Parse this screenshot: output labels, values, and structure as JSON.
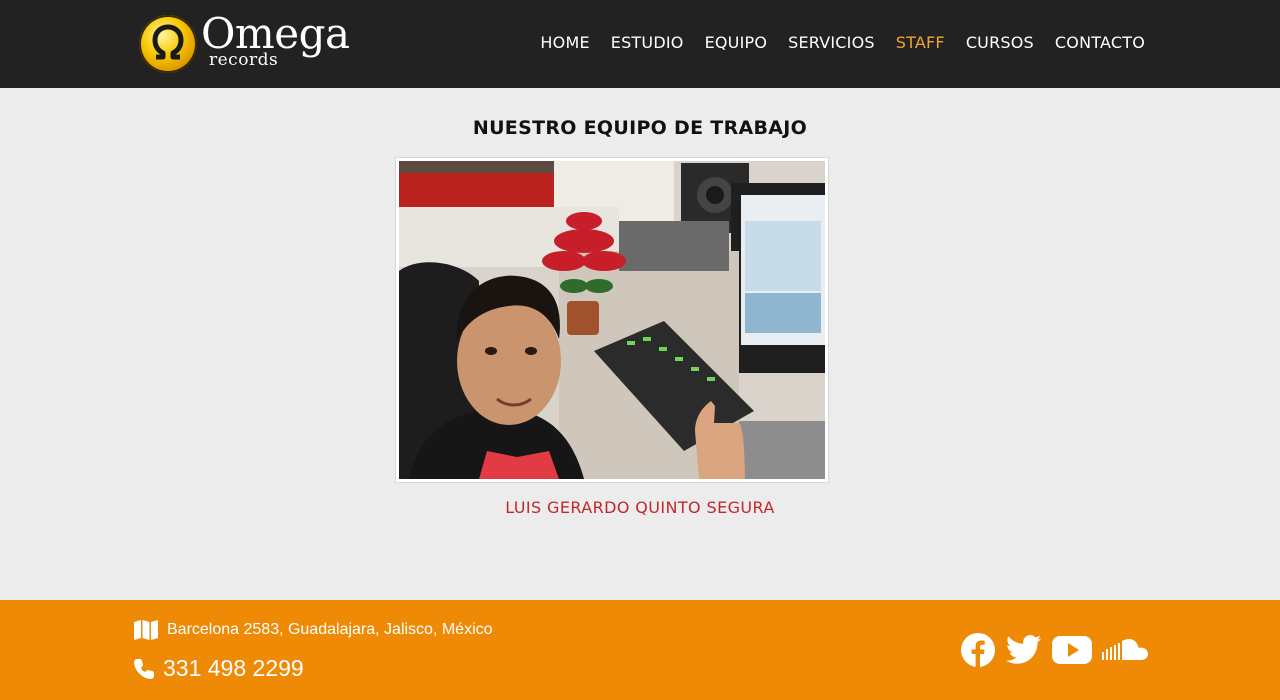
{
  "brand": {
    "name": "Omega",
    "sub": "records"
  },
  "nav": {
    "items": [
      {
        "label": "HOME",
        "active": false
      },
      {
        "label": "ESTUDIO",
        "active": false
      },
      {
        "label": "EQUIPO",
        "active": false
      },
      {
        "label": "SERVICIOS",
        "active": false
      },
      {
        "label": "STAFF",
        "active": true
      },
      {
        "label": "CURSOS",
        "active": false
      },
      {
        "label": "CONTACTO",
        "active": false
      }
    ]
  },
  "main": {
    "title": "NUESTRO EQUIPO DE TRABAJO",
    "member": {
      "name": "LUIS GERARDO QUINTO SEGURA"
    }
  },
  "footer": {
    "address": "Barcelona 2583, Guadalajara, Jalisco, México",
    "phone": "331 498 2299",
    "social": [
      "facebook-icon",
      "twitter-icon",
      "youtube-icon",
      "soundcloud-icon"
    ]
  },
  "colors": {
    "header_bg": "#222222",
    "accent": "#f0a52b",
    "footer_bg": "#ef8a07",
    "name_red": "#c0282d",
    "page_bg": "#ececec"
  }
}
